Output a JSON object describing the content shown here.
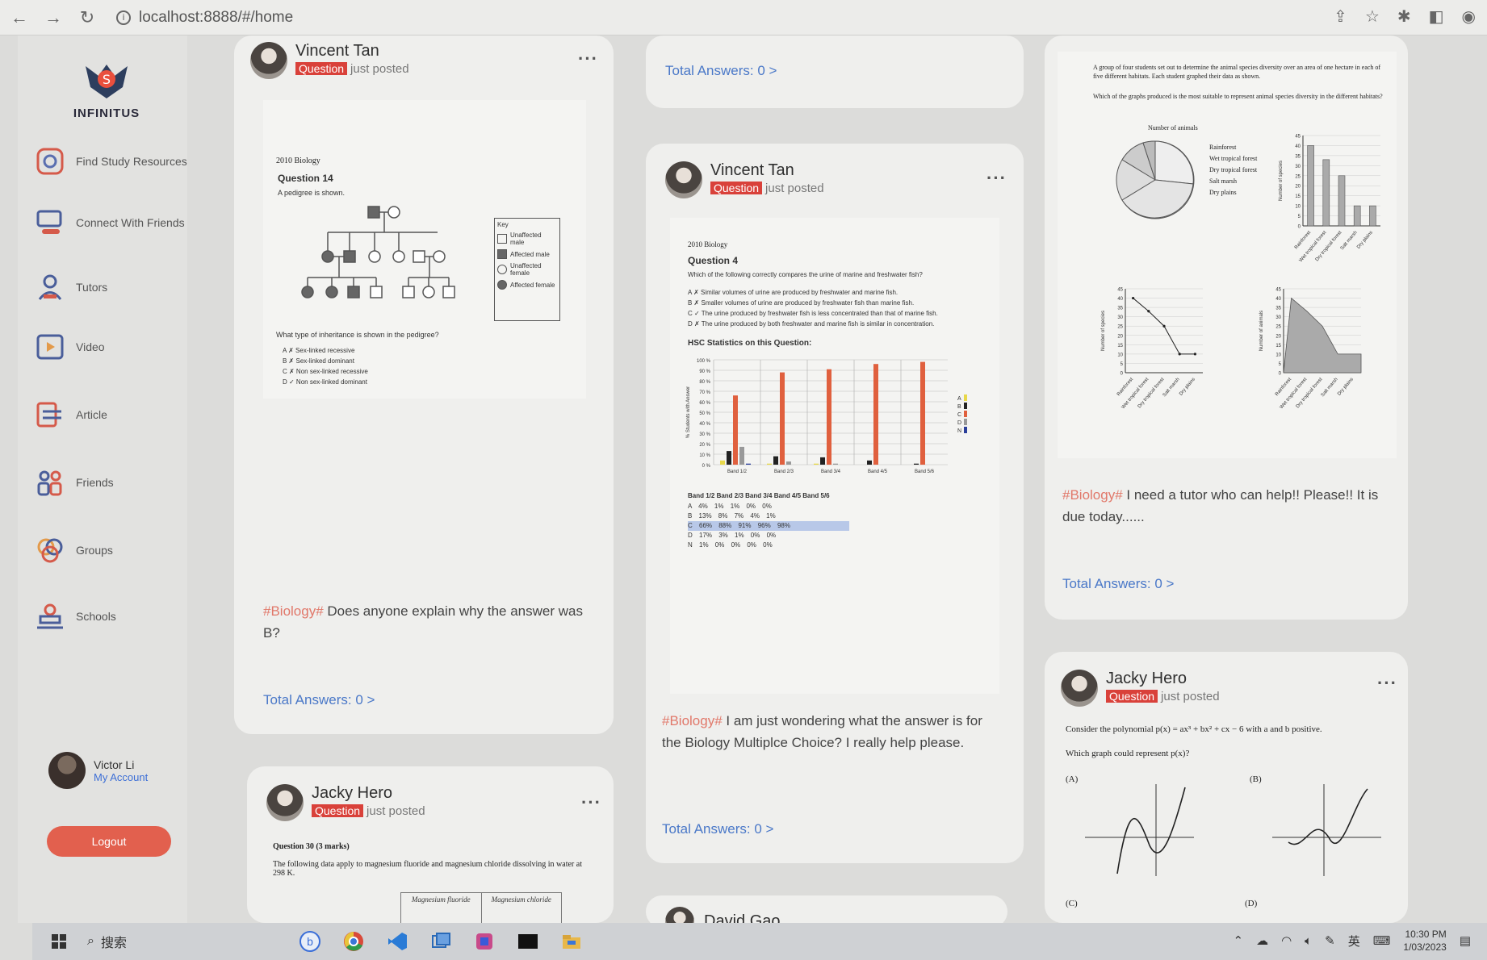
{
  "browser": {
    "url": "localhost:8888/#/home"
  },
  "sidebar": {
    "brand": "INFINITUS",
    "items": [
      {
        "label": "Find Study Resources",
        "icon": "study-resources-icon"
      },
      {
        "label": "Connect With Friends",
        "icon": "connect-friends-icon"
      },
      {
        "label": "Tutors",
        "icon": "tutor-icon"
      },
      {
        "label": "Video",
        "icon": "video-icon"
      },
      {
        "label": "Article",
        "icon": "article-icon"
      },
      {
        "label": "Friends",
        "icon": "friends-icon"
      },
      {
        "label": "Groups",
        "icon": "groups-icon"
      },
      {
        "label": "Schools",
        "icon": "schools-icon"
      }
    ],
    "account_name": "Victor Li",
    "account_link": "My Account",
    "logout": "Logout"
  },
  "posts": {
    "p1": {
      "author": "Vincent Tan",
      "tag": "Question",
      "meta": "just posted",
      "paper_title": "2010 Biology",
      "paper_question": "Question 14",
      "paper_prompt": "A pedigree is shown.",
      "paper_stem": "What type of inheritance is shown in the pedigree?",
      "options": [
        "A ✗ Sex-linked recessive",
        "B ✗ Sex-linked dominant",
        "C ✗ Non sex-linked recessive",
        "D ✓ Non sex-linked dominant"
      ],
      "key_title": "Key",
      "key_items": [
        "Unaffected male",
        "Affected male",
        "Unaffected female",
        "Affected female"
      ],
      "hashtag": "#Biology#",
      "text": " Does anyone explain why the answer was B?",
      "answers": "Total Answers: 0 >"
    },
    "p2_top": {
      "answers": "Total Answers: 0 >"
    },
    "p2": {
      "author": "Vincent Tan",
      "tag": "Question",
      "meta": "just posted",
      "paper_title": "2010 Biology",
      "paper_question": "Question 4",
      "paper_prompt": "Which of the following correctly compares the urine of marine and freshwater fish?",
      "options": [
        "A ✗ Similar volumes of urine are produced by freshwater and marine fish.",
        "B ✗ Smaller volumes of urine are produced by freshwater fish than marine fish.",
        "C ✓ The urine produced by freshwater fish is less concentrated than that of marine fish.",
        "D ✗ The urine produced by both freshwater and marine fish is similar in concentration."
      ],
      "stats_title": "HSC Statistics on this Question:",
      "hashtag": "#Biology#",
      "text": " I am just wondering what the answer is for the Biology Multiplce Choice? I really help please.",
      "answers": "Total Answers: 0 >"
    },
    "p2_next": {
      "author": "David Gao"
    },
    "p3_top": {
      "paper_intro": "A group of four students set out to determine the animal species diversity over an area of one hectare in each of five different habitats. Each student graphed their data as shown.",
      "paper_q": "Which of the graphs produced is the most suitable to represent animal species diversity in the different habitats?",
      "pie_title": "Number of animals",
      "legend": [
        "Rainforest",
        "Wet tropical forest",
        "Dry tropical forest",
        "Salt marsh",
        "Dry plains"
      ],
      "hashtag": "#Biology#",
      "text": " I need a tutor who can help!! Please!! It is due today......",
      "answers": "Total Answers: 0 >"
    },
    "p4": {
      "author": "Jacky Hero",
      "tag": "Question",
      "meta": "just posted",
      "paper_line1": "Consider the polynomial p(x) = ax³ + bx² + cx − 6 with a and b positive.",
      "paper_line2": "Which graph could represent p(x)?",
      "labels": [
        "(A)",
        "(B)",
        "(C)",
        "(D)"
      ]
    },
    "p5": {
      "author": "Jacky Hero",
      "tag": "Question",
      "meta": "just posted",
      "paper_q": "Question 30 (3 marks)",
      "paper_line": "The following data apply to magnesium fluoride and magnesium chloride dissolving in water at 298 K.",
      "col1": "Magnesium fluoride",
      "col2": "Magnesium chloride"
    }
  },
  "chart_data": [
    {
      "type": "bar",
      "title": "",
      "categories": [
        "Band 1/2",
        "Band 2/3",
        "Band 3/4",
        "Band 4/5",
        "Band 5/6"
      ],
      "series": [
        {
          "name": "A",
          "values": [
            4,
            1,
            1,
            0,
            0
          ]
        },
        {
          "name": "B",
          "values": [
            13,
            8,
            7,
            4,
            1
          ]
        },
        {
          "name": "C",
          "values": [
            66,
            88,
            91,
            96,
            98
          ]
        },
        {
          "name": "D",
          "values": [
            17,
            3,
            1,
            0,
            0
          ]
        },
        {
          "name": "N",
          "values": [
            1,
            0,
            0,
            0,
            0
          ]
        }
      ],
      "ylabel": "% Students with Answer",
      "ylim": [
        0,
        100
      ],
      "table_header": "Band 1/2 Band 2/3 Band 3/4 Band 4/5 Band 5/6",
      "table_rows": [
        "A 4%   1%   1%   0%   0%",
        "B 13%   8%   7%   4%   1%",
        "C 66%   88%   91%   96%   98%",
        "D 17%   3%   1%   0%   0%",
        "N 1%   0%   0%   0%   0%"
      ]
    },
    {
      "type": "bar",
      "ylabel": "Number of species",
      "categories": [
        "Rainforest",
        "Wet tropical forest",
        "Dry tropical forest",
        "Salt marsh",
        "Dry plains"
      ],
      "values": [
        40,
        33,
        25,
        10,
        10
      ],
      "ylim": [
        0,
        45
      ]
    },
    {
      "type": "line",
      "ylabel": "Number of species",
      "categories": [
        "Rainforest",
        "Wet tropical forest",
        "Dry tropical forest",
        "Salt marsh",
        "Dry plains"
      ],
      "values": [
        40,
        33,
        25,
        10,
        10
      ],
      "ylim": [
        0,
        45
      ]
    },
    {
      "type": "area",
      "ylabel": "Number of animals",
      "categories": [
        "Rainforest",
        "Wet tropical forest",
        "Dry tropical forest",
        "Salt marsh",
        "Dry plains"
      ],
      "values": [
        40,
        33,
        25,
        10,
        10
      ],
      "ylim": [
        0,
        45
      ]
    }
  ],
  "taskbar": {
    "search": "搜索",
    "lang": "英",
    "time": "10:30 PM",
    "date": "1/03/2023"
  }
}
